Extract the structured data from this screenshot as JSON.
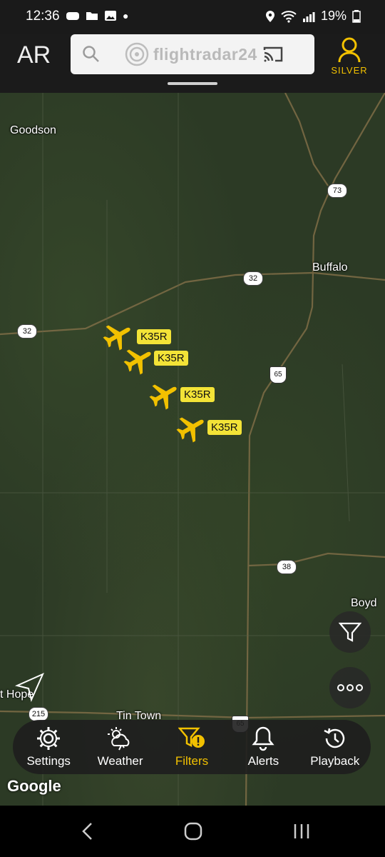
{
  "status": {
    "time": "12:36",
    "battery": "19%"
  },
  "header": {
    "ar_label": "AR",
    "logo_text": "flightradar24",
    "tier_label": "SILVER"
  },
  "map": {
    "places": {
      "goodson": "Goodson",
      "buffalo": "Buffalo",
      "boyd": "Boyd",
      "tin_town": "Tin Town",
      "fort_hope": "t Hope"
    },
    "roads": {
      "r73": "73",
      "r32a": "32",
      "r32b": "32",
      "r65a": "65",
      "r38": "38",
      "r215": "215",
      "r65b": "65",
      "r65top": "65"
    },
    "aircraft": [
      {
        "callsign": "K35R"
      },
      {
        "callsign": "K35R"
      },
      {
        "callsign": "K35R"
      },
      {
        "callsign": "K35R"
      }
    ]
  },
  "bottom_nav": {
    "settings": "Settings",
    "weather": "Weather",
    "filters": "Filters",
    "alerts": "Alerts",
    "playback": "Playback"
  },
  "attribution": "Google",
  "colors": {
    "accent": "#f2c100",
    "callsign_bg": "#f3e337"
  }
}
